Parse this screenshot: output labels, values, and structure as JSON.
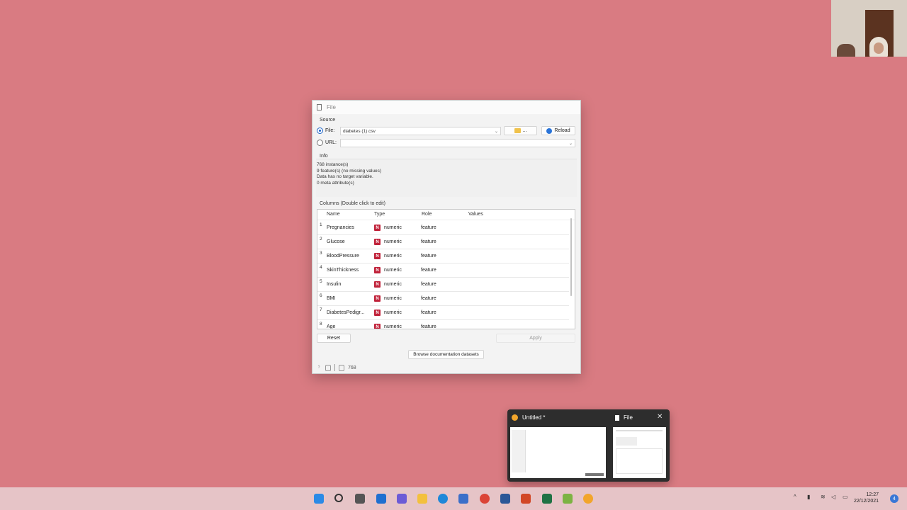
{
  "window": {
    "title": "File",
    "source_label": "Source",
    "file_label": "File:",
    "file_value": "diabetes (1).csv",
    "browse_label": "...",
    "reload_label": "Reload",
    "url_label": "URL:",
    "url_value": "",
    "info_label": "Info",
    "info_lines": [
      "768 instance(s)",
      "9 feature(s) (no missing values)",
      "Data has no target variable.",
      "0 meta attribute(s)"
    ],
    "columns_label": "Columns (Double click to edit)",
    "headers": [
      "Name",
      "Type",
      "Role",
      "Values"
    ],
    "rows": [
      {
        "num": "1",
        "name": "Pregnancies",
        "type": "numeric",
        "role": "feature"
      },
      {
        "num": "2",
        "name": "Glucose",
        "type": "numeric",
        "role": "feature"
      },
      {
        "num": "3",
        "name": "BloodPressure",
        "type": "numeric",
        "role": "feature"
      },
      {
        "num": "4",
        "name": "SkinThickness",
        "type": "numeric",
        "role": "feature"
      },
      {
        "num": "5",
        "name": "Insulin",
        "type": "numeric",
        "role": "feature"
      },
      {
        "num": "6",
        "name": "BMI",
        "type": "numeric",
        "role": "feature"
      },
      {
        "num": "7",
        "name": "DiabetesPedigr...",
        "type": "numeric",
        "role": "feature"
      },
      {
        "num": "8",
        "name": "Age",
        "type": "numeric",
        "role": "feature"
      }
    ],
    "type_badge": "N",
    "reset_label": "Reset",
    "apply_label": "Apply",
    "browse_docs_label": "Browse documentation datasets",
    "status_count": "768"
  },
  "popup": {
    "task1_title": "Untitled *",
    "task2_title": "File",
    "close": "✕"
  },
  "taskbar": {
    "time": "12:27",
    "date": "22/12/2021",
    "notification_count": "4"
  },
  "colors": {
    "desktop": "#d97b82",
    "accent": "#1a63c8",
    "numeric_badge": "#c0223a"
  }
}
